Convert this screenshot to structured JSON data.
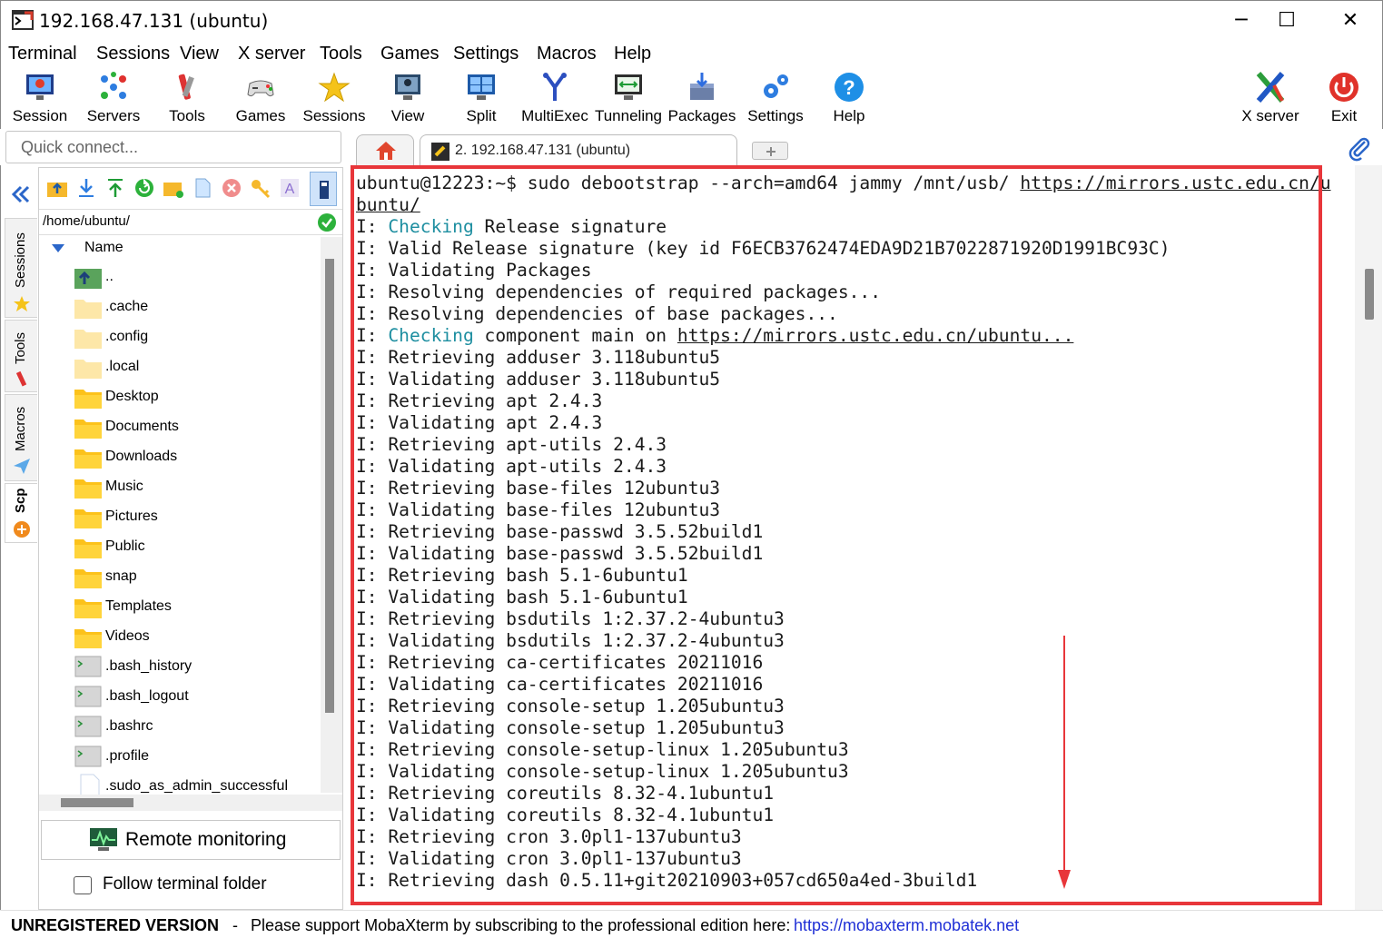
{
  "window": {
    "title": "192.168.47.131 (ubuntu)",
    "minimize": "─",
    "maximize": "☐",
    "close": "✕"
  },
  "menu": [
    "Terminal",
    "Sessions",
    "View",
    "X server",
    "Tools",
    "Games",
    "Settings",
    "Macros",
    "Help"
  ],
  "toolbar": {
    "session": "Session",
    "servers": "Servers",
    "tools": "Tools",
    "games": "Games",
    "sessions": "Sessions",
    "view": "View",
    "split": "Split",
    "multiexec": "MultiExec",
    "tunneling": "Tunneling",
    "packages": "Packages",
    "settings": "Settings",
    "help": "Help",
    "xserver": "X server",
    "exit": "Exit"
  },
  "quick_connect": {
    "placeholder": "Quick connect..."
  },
  "tabs": {
    "active": "2. 192.168.47.131 (ubuntu)"
  },
  "side_tabs": {
    "sessions": "Sessions",
    "tools": "Tools",
    "macros": "Macros",
    "scp": "Scp"
  },
  "file_browser": {
    "path": "/home/ubuntu/",
    "column": "Name",
    "files": [
      {
        "name": "..",
        "type": "up"
      },
      {
        "name": ".cache",
        "type": "folder-light"
      },
      {
        "name": ".config",
        "type": "folder-light"
      },
      {
        "name": ".local",
        "type": "folder-light"
      },
      {
        "name": "Desktop",
        "type": "folder"
      },
      {
        "name": "Documents",
        "type": "folder"
      },
      {
        "name": "Downloads",
        "type": "folder"
      },
      {
        "name": "Music",
        "type": "folder"
      },
      {
        "name": "Pictures",
        "type": "folder"
      },
      {
        "name": "Public",
        "type": "folder"
      },
      {
        "name": "snap",
        "type": "folder"
      },
      {
        "name": "Templates",
        "type": "folder"
      },
      {
        "name": "Videos",
        "type": "folder"
      },
      {
        "name": ".bash_history",
        "type": "script"
      },
      {
        "name": ".bash_logout",
        "type": "script"
      },
      {
        "name": ".bashrc",
        "type": "script"
      },
      {
        "name": ".profile",
        "type": "script"
      },
      {
        "name": ".sudo_as_admin_successful",
        "type": "file"
      }
    ],
    "remote_monitoring": "Remote monitoring",
    "follow_terminal": "Follow terminal folder"
  },
  "terminal": {
    "lines": [
      [
        {
          "t": "ubuntu@12223:~$ sudo debootstrap --arch=amd64 jammy /mnt/usb/ "
        },
        {
          "t": "https://mirrors.ustc.edu.cn/u",
          "c": "url"
        }
      ],
      [
        {
          "t": "buntu/",
          "c": "url"
        }
      ],
      [
        {
          "t": "I: "
        },
        {
          "t": "Checking",
          "c": "kw"
        },
        {
          "t": " Release signature"
        }
      ],
      [
        {
          "t": "I: Valid Release signature (key id F6ECB3762474EDA9D21B7022871920D1991BC93C)"
        }
      ],
      [
        {
          "t": "I: Validating Packages"
        }
      ],
      [
        {
          "t": "I: Resolving dependencies of required packages..."
        }
      ],
      [
        {
          "t": "I: Resolving dependencies of base packages..."
        }
      ],
      [
        {
          "t": "I: "
        },
        {
          "t": "Checking",
          "c": "kw"
        },
        {
          "t": " component main on "
        },
        {
          "t": "https://mirrors.ustc.edu.cn/ubuntu...",
          "c": "url"
        }
      ],
      [
        {
          "t": "I: Retrieving adduser 3.118ubuntu5"
        }
      ],
      [
        {
          "t": "I: Validating adduser 3.118ubuntu5"
        }
      ],
      [
        {
          "t": "I: Retrieving apt 2.4.3"
        }
      ],
      [
        {
          "t": "I: Validating apt 2.4.3"
        }
      ],
      [
        {
          "t": "I: Retrieving apt-utils 2.4.3"
        }
      ],
      [
        {
          "t": "I: Validating apt-utils 2.4.3"
        }
      ],
      [
        {
          "t": "I: Retrieving base-files 12ubuntu3"
        }
      ],
      [
        {
          "t": "I: Validating base-files 12ubuntu3"
        }
      ],
      [
        {
          "t": "I: Retrieving base-passwd 3.5.52build1"
        }
      ],
      [
        {
          "t": "I: Validating base-passwd 3.5.52build1"
        }
      ],
      [
        {
          "t": "I: Retrieving bash 5.1-6ubuntu1"
        }
      ],
      [
        {
          "t": "I: Validating bash 5.1-6ubuntu1"
        }
      ],
      [
        {
          "t": "I: Retrieving bsdutils 1:2.37.2-4ubuntu3"
        }
      ],
      [
        {
          "t": "I: Validating bsdutils 1:2.37.2-4ubuntu3"
        }
      ],
      [
        {
          "t": "I: Retrieving ca-certificates 20211016"
        }
      ],
      [
        {
          "t": "I: Validating ca-certificates 20211016"
        }
      ],
      [
        {
          "t": "I: Retrieving console-setup 1.205ubuntu3"
        }
      ],
      [
        {
          "t": "I: Validating console-setup 1.205ubuntu3"
        }
      ],
      [
        {
          "t": "I: Retrieving console-setup-linux 1.205ubuntu3"
        }
      ],
      [
        {
          "t": "I: Validating console-setup-linux 1.205ubuntu3"
        }
      ],
      [
        {
          "t": "I: Retrieving coreutils 8.32-4.1ubuntu1"
        }
      ],
      [
        {
          "t": "I: Validating coreutils 8.32-4.1ubuntu1"
        }
      ],
      [
        {
          "t": "I: Retrieving cron 3.0pl1-137ubuntu3"
        }
      ],
      [
        {
          "t": "I: Validating cron 3.0pl1-137ubuntu3"
        }
      ],
      [
        {
          "t": "I: Retrieving dash 0.5.11+git20210903+057cd650a4ed-3build1"
        }
      ]
    ]
  },
  "status": {
    "unregistered": "UNREGISTERED VERSION",
    "dash": "-",
    "message": "Please support MobaXterm by subscribing to the professional edition here:",
    "link": "https://mobaxterm.mobatek.net"
  },
  "colors": {
    "highlight_border": "#e8363a",
    "keyword": "#1d8ea0",
    "link": "#1f2fd6"
  }
}
